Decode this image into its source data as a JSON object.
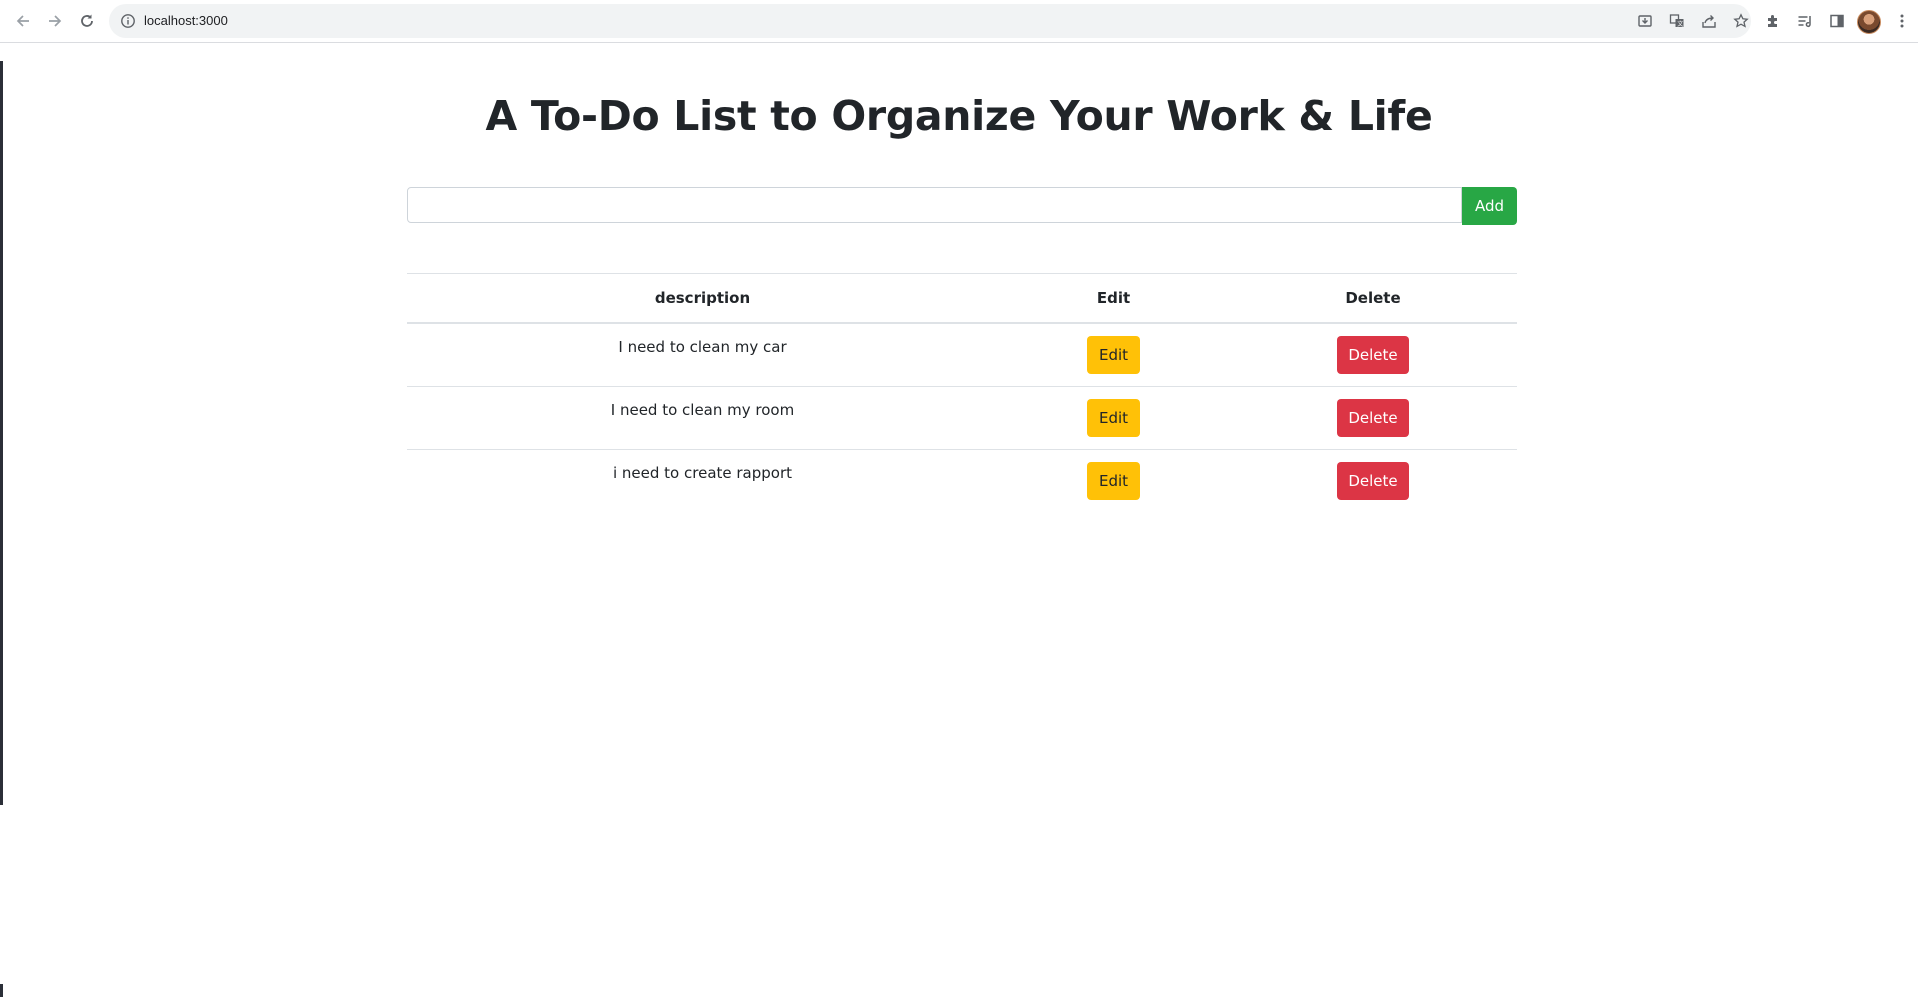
{
  "browser": {
    "url": "localhost:3000",
    "icons": [
      "back-arrow-icon",
      "forward-arrow-icon",
      "reload-icon",
      "info-icon",
      "install-app-icon",
      "translate-icon",
      "share-icon",
      "bookmark-star-icon",
      "extensions-icon",
      "reading-list-icon",
      "side-panel-icon",
      "profile-avatar",
      "more-menu-icon"
    ]
  },
  "page": {
    "title": "A To-Do List to Organize Your Work & Life"
  },
  "form": {
    "input_value": "",
    "add_label": "Add"
  },
  "table": {
    "headers": [
      "description",
      "Edit",
      "Delete"
    ],
    "rows": [
      {
        "description": "I need to clean my car",
        "edit_label": "Edit",
        "delete_label": "Delete"
      },
      {
        "description": "I need to clean my room",
        "edit_label": "Edit",
        "delete_label": "Delete"
      },
      {
        "description": "i need to create rapport",
        "edit_label": "Edit",
        "delete_label": "Delete"
      }
    ]
  },
  "colors": {
    "add": "#28a745",
    "edit": "#ffc107",
    "delete": "#dc3545"
  }
}
